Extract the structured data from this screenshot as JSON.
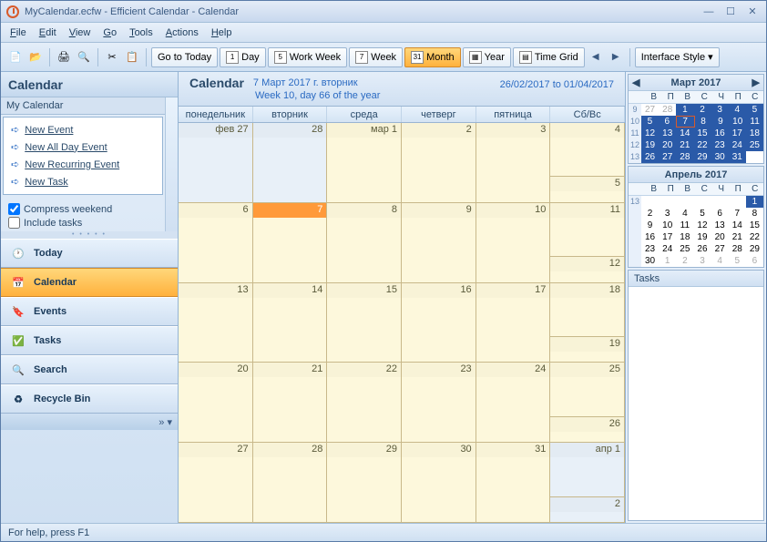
{
  "window": {
    "file": "MyCalendar.ecfw",
    "app": "Efficient Calendar",
    "module": "Calendar"
  },
  "menu": [
    "File",
    "Edit",
    "View",
    "Go",
    "Tools",
    "Actions",
    "Help"
  ],
  "toolbar": {
    "go_today": "Go to Today",
    "day": "Day",
    "work_week": "Work Week",
    "week": "Week",
    "month": "Month",
    "year": "Year",
    "time_grid": "Time Grid",
    "style": "Interface Style"
  },
  "sidebar": {
    "title": "Calendar",
    "sub": "My Calendar",
    "links": {
      "new_event": "New Event",
      "new_all_day": "New All Day Event",
      "new_recurring": "New Recurring Event",
      "new_task": "New Task"
    },
    "compress": "Compress weekend",
    "include": "Include tasks",
    "nav": {
      "today": "Today",
      "calendar": "Calendar",
      "events": "Events",
      "tasks": "Tasks",
      "search": "Search",
      "recycle": "Recycle Bin"
    }
  },
  "cal_header": {
    "title": "Calendar",
    "date": "7 Март 2017 г. вторник",
    "sub": "Week 10, day 66 of the year",
    "range": "26/02/2017 to 01/04/2017"
  },
  "days": [
    "понедельник",
    "вторник",
    "среда",
    "четверг",
    "пятница",
    "Сб/Вс"
  ],
  "grid": [
    [
      {
        "t": "фев 27",
        "o": true
      },
      {
        "t": "28",
        "o": true
      },
      {
        "t": "мар 1"
      },
      {
        "t": "2"
      },
      {
        "t": "3"
      },
      {
        "sb": [
          "4",
          "5"
        ]
      }
    ],
    [
      {
        "t": "6"
      },
      {
        "t": "7",
        "today": true
      },
      {
        "t": "8"
      },
      {
        "t": "9"
      },
      {
        "t": "10"
      },
      {
        "sb": [
          "11",
          "12"
        ]
      }
    ],
    [
      {
        "t": "13"
      },
      {
        "t": "14"
      },
      {
        "t": "15"
      },
      {
        "t": "16"
      },
      {
        "t": "17"
      },
      {
        "sb": [
          "18",
          "19"
        ]
      }
    ],
    [
      {
        "t": "20"
      },
      {
        "t": "21"
      },
      {
        "t": "22"
      },
      {
        "t": "23"
      },
      {
        "t": "24"
      },
      {
        "sb": [
          "25",
          "26"
        ]
      }
    ],
    [
      {
        "t": "27"
      },
      {
        "t": "28"
      },
      {
        "t": "29"
      },
      {
        "t": "30"
      },
      {
        "t": "31"
      },
      {
        "sb": [
          "апр 1",
          "2"
        ],
        "o": true
      }
    ]
  ],
  "mini1": {
    "title": "Март 2017",
    "dow": [
      "",
      "В",
      "П",
      "В",
      "С",
      "Ч",
      "П",
      "С"
    ],
    "rows": [
      {
        "wn": "9",
        "d": [
          {
            "t": "27",
            "dim": true
          },
          {
            "t": "28",
            "dim": true
          },
          {
            "t": "1",
            "sel": true
          },
          {
            "t": "2",
            "sel": true
          },
          {
            "t": "3",
            "sel": true
          },
          {
            "t": "4",
            "sel": true
          },
          {
            "t": "5",
            "sel": true
          }
        ]
      },
      {
        "wn": "10",
        "d": [
          {
            "t": "5",
            "sel": true
          },
          {
            "t": "6",
            "sel": true
          },
          {
            "t": "7",
            "sel": true,
            "today": true
          },
          {
            "t": "8",
            "sel": true
          },
          {
            "t": "9",
            "sel": true
          },
          {
            "t": "10",
            "sel": true
          },
          {
            "t": "11",
            "sel": true
          }
        ]
      },
      {
        "wn": "11",
        "d": [
          {
            "t": "12",
            "sel": true
          },
          {
            "t": "13",
            "sel": true
          },
          {
            "t": "14",
            "sel": true
          },
          {
            "t": "15",
            "sel": true
          },
          {
            "t": "16",
            "sel": true
          },
          {
            "t": "17",
            "sel": true
          },
          {
            "t": "18",
            "sel": true
          }
        ]
      },
      {
        "wn": "12",
        "d": [
          {
            "t": "19",
            "sel": true
          },
          {
            "t": "20",
            "sel": true
          },
          {
            "t": "21",
            "sel": true
          },
          {
            "t": "22",
            "sel": true
          },
          {
            "t": "23",
            "sel": true
          },
          {
            "t": "24",
            "sel": true
          },
          {
            "t": "25",
            "sel": true
          }
        ]
      },
      {
        "wn": "13",
        "d": [
          {
            "t": "26",
            "sel": true
          },
          {
            "t": "27",
            "sel": true
          },
          {
            "t": "28",
            "sel": true
          },
          {
            "t": "29",
            "sel": true
          },
          {
            "t": "30",
            "sel": true
          },
          {
            "t": "31",
            "sel": true
          },
          {
            "t": ""
          }
        ]
      }
    ]
  },
  "mini2": {
    "title": "Апрель 2017",
    "dow": [
      "",
      "В",
      "П",
      "В",
      "С",
      "Ч",
      "П",
      "С"
    ],
    "rows": [
      {
        "wn": "13",
        "d": [
          {
            "t": ""
          },
          {
            "t": ""
          },
          {
            "t": ""
          },
          {
            "t": ""
          },
          {
            "t": ""
          },
          {
            "t": ""
          },
          {
            "t": "1",
            "sel": true
          }
        ]
      },
      {
        "wn": "",
        "d": [
          {
            "t": "2"
          },
          {
            "t": "3"
          },
          {
            "t": "4"
          },
          {
            "t": "5"
          },
          {
            "t": "6"
          },
          {
            "t": "7"
          },
          {
            "t": "8"
          }
        ]
      },
      {
        "wn": "",
        "d": [
          {
            "t": "9"
          },
          {
            "t": "10"
          },
          {
            "t": "11"
          },
          {
            "t": "12"
          },
          {
            "t": "13"
          },
          {
            "t": "14"
          },
          {
            "t": "15"
          }
        ]
      },
      {
        "wn": "",
        "d": [
          {
            "t": "16"
          },
          {
            "t": "17"
          },
          {
            "t": "18"
          },
          {
            "t": "19"
          },
          {
            "t": "20"
          },
          {
            "t": "21"
          },
          {
            "t": "22"
          }
        ]
      },
      {
        "wn": "",
        "d": [
          {
            "t": "23"
          },
          {
            "t": "24"
          },
          {
            "t": "25"
          },
          {
            "t": "26"
          },
          {
            "t": "27"
          },
          {
            "t": "28"
          },
          {
            "t": "29"
          }
        ]
      },
      {
        "wn": "",
        "d": [
          {
            "t": "30"
          },
          {
            "t": "1",
            "dim": true
          },
          {
            "t": "2",
            "dim": true
          },
          {
            "t": "3",
            "dim": true
          },
          {
            "t": "4",
            "dim": true
          },
          {
            "t": "5",
            "dim": true
          },
          {
            "t": "6",
            "dim": true
          }
        ]
      }
    ]
  },
  "tasks_title": "Tasks",
  "status": "For help, press F1"
}
